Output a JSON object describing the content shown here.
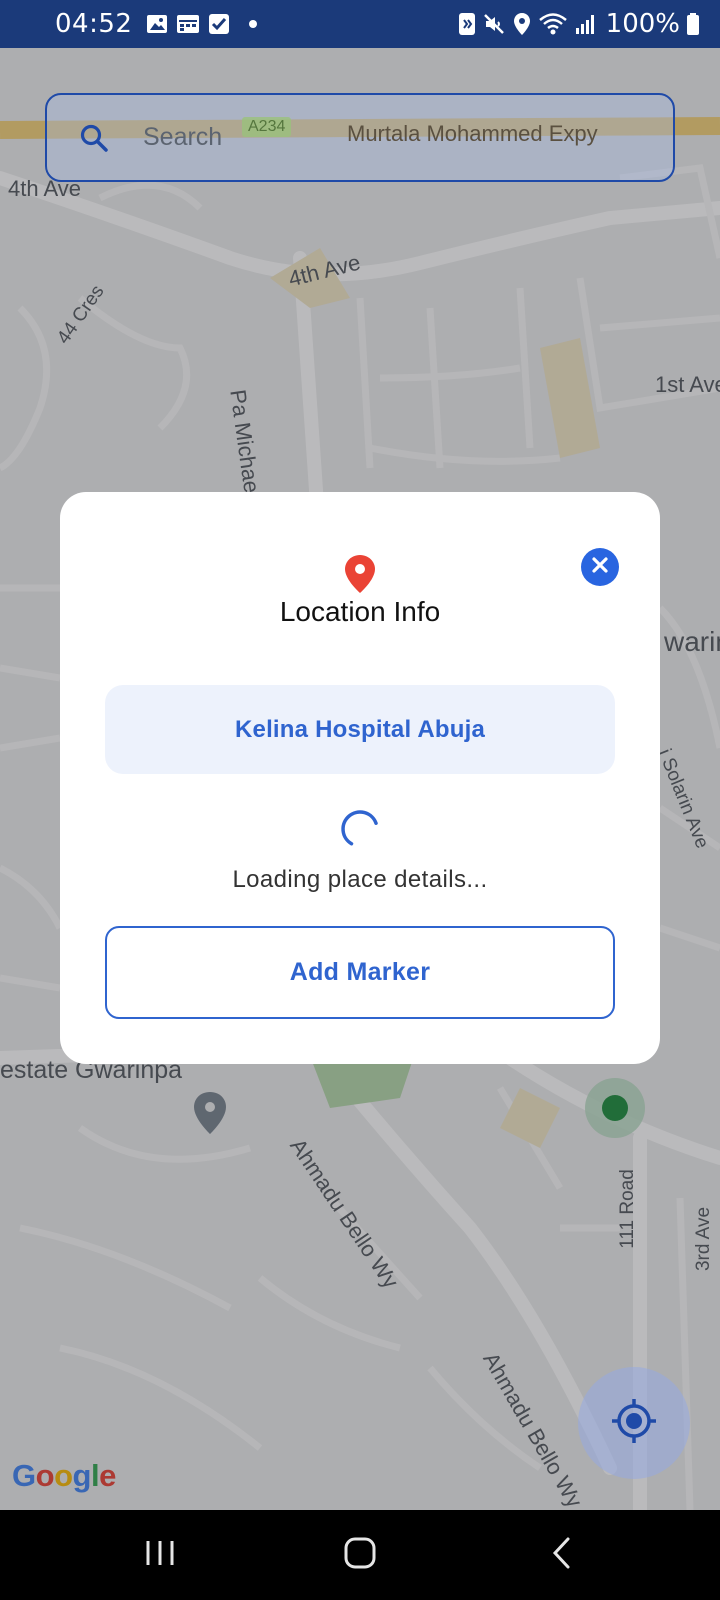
{
  "status_bar": {
    "time": "04:52",
    "battery": "100%",
    "left_icons": [
      "image-icon",
      "calendar-icon",
      "checkbox-icon",
      "dot-icon"
    ],
    "right_icons": [
      "nfc-icon",
      "mute-icon",
      "location-icon",
      "wifi-icon",
      "signal-icon",
      "battery-icon"
    ]
  },
  "search": {
    "placeholder": "Search",
    "overlay_highway_shield": "A234",
    "overlay_highway_name": "Murtala Mohammed Expy"
  },
  "map": {
    "labels": {
      "fourth_ave_a": "4th Ave",
      "fourth_ave_b": "4th Ave",
      "cres_44": "44 Cres",
      "pa_michael": "Pa Michael Imoudu",
      "first_ave": "1st Ave",
      "gwarin": "warin",
      "solarin": "i Solarin Ave",
      "estate": "estate Gwarinpa",
      "ahmadu_a": "Ahmadu Bello Wy",
      "ahmadu_b": "Ahmadu Bello Wy",
      "road_111": "111 Road",
      "third_ave": "3rd Ave"
    },
    "google_logo": [
      "G",
      "o",
      "o",
      "g",
      "l",
      "e"
    ]
  },
  "dialog": {
    "title": "Location Info",
    "place_name": "Kelina Hospital Abuja",
    "loading_text": "Loading place details...",
    "add_marker_label": "Add Marker"
  },
  "colors": {
    "accent": "#2F64CF",
    "status_bar": "#1B3A7A",
    "pin": "#EA4335",
    "close_button": "#2965E0"
  }
}
